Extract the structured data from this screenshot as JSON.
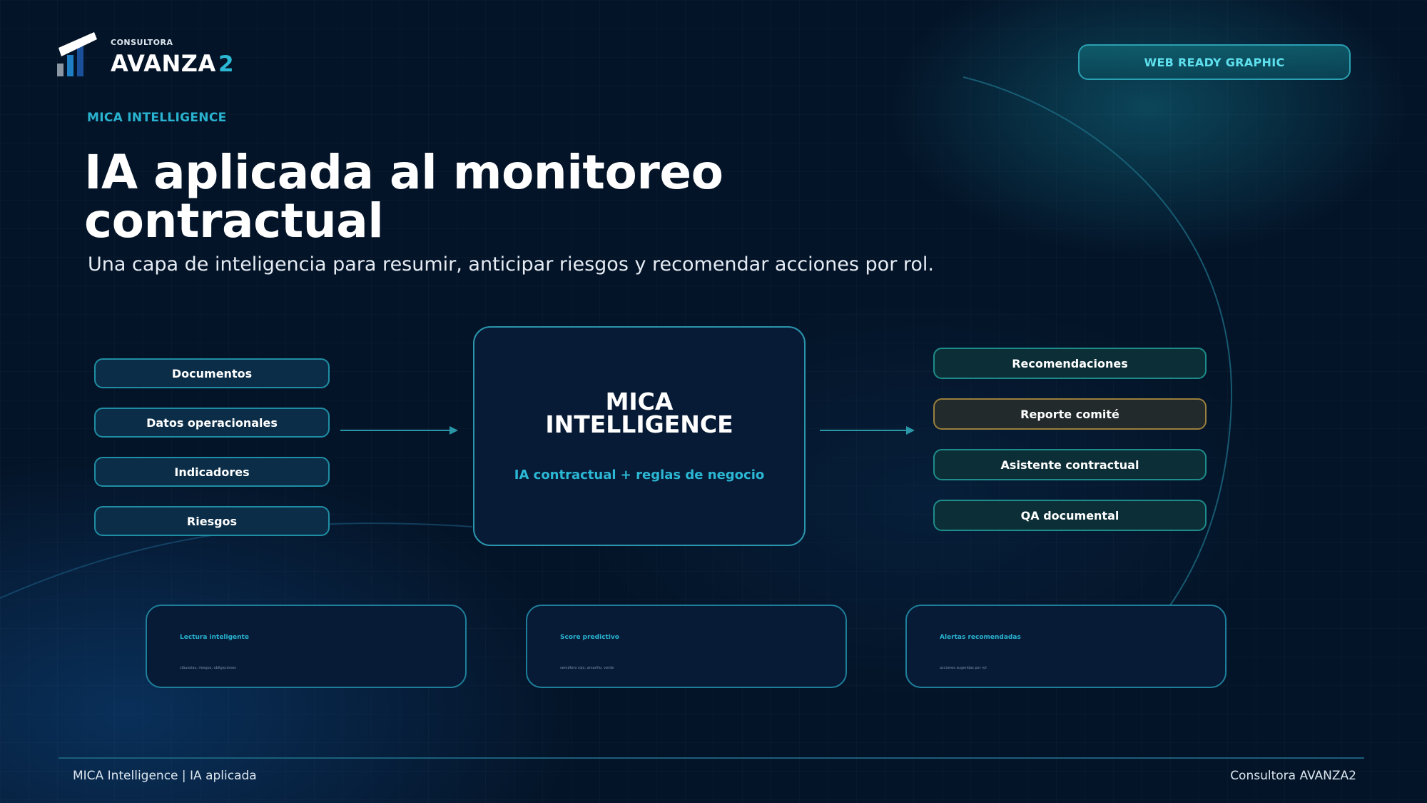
{
  "brand": {
    "small": "CONSULTORA",
    "name": "AVANZA",
    "number": "2",
    "logo_icon": "rising-bars-logo-icon"
  },
  "badge": {
    "label": "WEB READY GRAPHIC"
  },
  "eyebrow": "MICA INTELLIGENCE",
  "title": {
    "line1": "IA aplicada al monitoreo",
    "line2": "contractual"
  },
  "subtitle": "Una capa de inteligencia para resumir, anticipar riesgos y recomendar acciones por rol.",
  "inputs": [
    {
      "label": "Documentos"
    },
    {
      "label": "Datos operacionales"
    },
    {
      "label": "Indicadores"
    },
    {
      "label": "Riesgos"
    }
  ],
  "center": {
    "title_line1": "MICA",
    "title_line2": "INTELLIGENCE",
    "subtitle": "IA contractual + reglas de negocio"
  },
  "outputs": [
    {
      "label": "Recomendaciones"
    },
    {
      "label": "Reporte comité"
    },
    {
      "label": "Asistente contractual"
    },
    {
      "label": "QA documental"
    }
  ],
  "cards": [
    {
      "title": "Lectura inteligente",
      "text": "cláusulas, riesgos, obligaciones"
    },
    {
      "title": "Score predictivo",
      "text": "semáforo rojo, amarillo, verde"
    },
    {
      "title": "Alertas recomendadas",
      "text": "acciones sugeridas por rol"
    }
  ],
  "footer": {
    "left": "MICA Intelligence | IA aplicada",
    "right": "Consultora AVANZA2"
  },
  "colors": {
    "background": "#041428",
    "accent": "#2bb8d4",
    "input_border": "#1f8ea4",
    "output_border": "#1e8c8a",
    "highlight_border": "#9b7f3d"
  }
}
